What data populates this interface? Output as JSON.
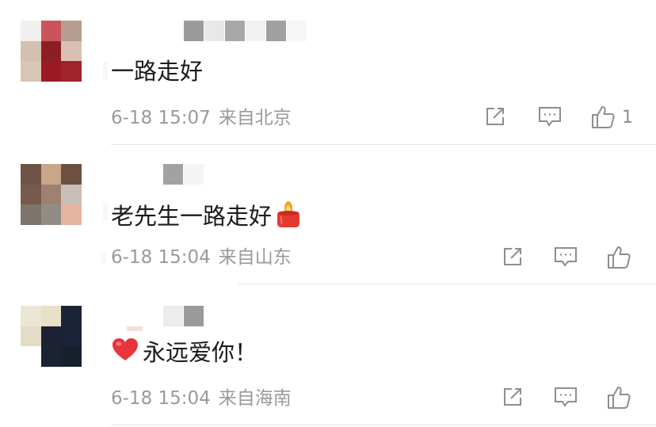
{
  "comments": [
    {
      "avatar_colors": [
        "#f2f0ee",
        "#c9545a",
        "#b59e90",
        "#d4c0b0",
        "#8e1e26",
        "#dcbfb4",
        "#d9c5b3",
        "#9a1a24",
        "#a0222c"
      ],
      "name_blocks": [
        "#9b9b9b",
        "#e8e8e8",
        "#a8a8a8",
        "#f2f2f2",
        "#a0a0a0",
        "#f6f6f6"
      ],
      "text": "一路走好",
      "emoji": "",
      "time": "6-18 15:07",
      "location": "来自北京",
      "like_count": "1"
    },
    {
      "avatar_colors": [
        "#6f5346",
        "#c9a58a",
        "#6c5141",
        "#765a4e",
        "#a08070",
        "#c9bfb7",
        "#7d756c",
        "#928c86",
        "#e5b4a0"
      ],
      "name_blocks": [
        "#ffffff",
        "#a2a2a2",
        "#f4f4f4"
      ],
      "text": "老先生一路走好",
      "emoji": "candle",
      "time": "6-18 15:04",
      "location": "来自山东",
      "like_count": ""
    },
    {
      "avatar_colors": [
        "#ece6d6",
        "#e8e0c8",
        "#1c2536",
        "#e4dcc6",
        "#1c2233",
        "#1a2438",
        "#ffffff",
        "#1b2233",
        "#18202e"
      ],
      "name_blocks": [
        "#ececec",
        "#9a9a9a"
      ],
      "text": "永远爱你！",
      "emoji": "heart",
      "time": "6-18 15:04",
      "location": "来自海南",
      "like_count": ""
    }
  ],
  "colors": {
    "text": "#1a1a1a",
    "meta": "#9a9a9a",
    "icon": "#8e8e8e",
    "divider": "#e6e6e6",
    "heart": "#e8343c",
    "candle": "#e23a2e"
  },
  "icons": {
    "share": "share-icon",
    "comment": "comment-icon",
    "like": "thumbs-up-icon"
  }
}
